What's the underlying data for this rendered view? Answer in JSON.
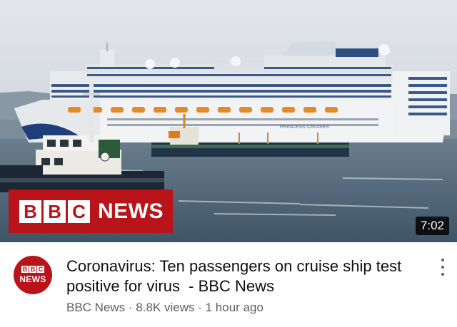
{
  "thumbnail": {
    "overlay_logo_letters": [
      "B",
      "B",
      "C"
    ],
    "overlay_logo_text": "NEWS",
    "duration": "7:02",
    "ship_text": "PRINCESS CRUISES",
    "colors": {
      "sky": "#d9dde2",
      "sea": "#4e6474",
      "hull": "#f2f3f4",
      "brand_red": "#b8141a"
    }
  },
  "video": {
    "title": "Coronavirus: Ten passengers on cruise ship test positive for virus  - BBC News",
    "channel": "BBC News",
    "separator": " · ",
    "views": "8.8K views",
    "age": "1 hour ago"
  },
  "avatar": {
    "letters": [
      "B",
      "B",
      "C"
    ],
    "text": "NEWS"
  },
  "icons": {
    "menu": "kebab-menu-icon"
  }
}
